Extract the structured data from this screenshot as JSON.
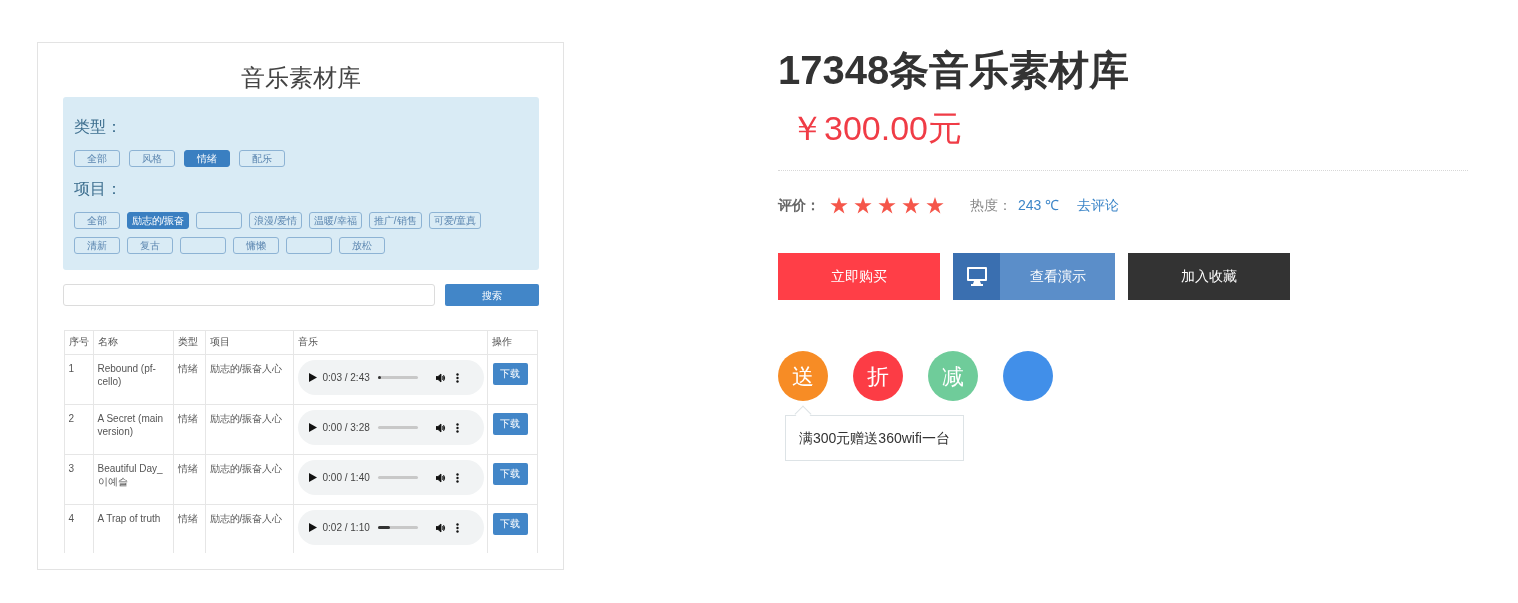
{
  "preview": {
    "title": "音乐素材库",
    "type_label": "类型：",
    "type_filters": [
      {
        "label": "全部",
        "selected": false
      },
      {
        "label": "风格",
        "selected": false
      },
      {
        "label": "情绪",
        "selected": true
      },
      {
        "label": "配乐",
        "selected": false
      }
    ],
    "project_label": "项目：",
    "project_filters": [
      [
        {
          "label": "全部",
          "selected": false
        },
        {
          "label": "励志的/振奋",
          "selected": true
        },
        {
          "selected": false
        },
        {
          "label": "浪漫/爱情",
          "selected": false
        },
        {
          "label": "温暖/幸福",
          "selected": false
        },
        {
          "label": "推广/销售",
          "selected": false
        },
        {
          "label": "可爱/童真",
          "selected": false
        }
      ],
      [
        {
          "label": "清新",
          "selected": false
        },
        {
          "label": "复古",
          "selected": false
        },
        {
          "selected": false
        },
        {
          "label": "慵懒",
          "selected": false
        },
        {
          "selected": false
        },
        {
          "label": "放松",
          "selected": false
        }
      ]
    ],
    "search_button": "搜索",
    "table": {
      "columns": [
        "序号",
        "名称",
        "类型",
        "项目",
        "音乐",
        "操作"
      ],
      "rows": [
        {
          "no": "1",
          "name": "Rebound (pf-cello)",
          "type": "情绪",
          "project": "励志的/振奋人心",
          "time": "0:03 / 2:43",
          "level": 0.08,
          "action": "下载"
        },
        {
          "no": "2",
          "name": "A Secret (main version)",
          "type": "情绪",
          "project": "励志的/振奋人心",
          "time": "0:00 / 3:28",
          "level": 0,
          "action": "下载"
        },
        {
          "no": "3",
          "name": "Beautiful Day_ 이예슬",
          "type": "情绪",
          "project": "励志的/振奋人心",
          "time": "0:00 / 1:40",
          "level": 0,
          "action": "下载"
        },
        {
          "no": "4",
          "name": "A Trap of truth",
          "type": "情绪",
          "project": "励志的/振奋人心",
          "time": "0:02 / 1:10",
          "level": 0.3,
          "action": "下载"
        }
      ]
    }
  },
  "product": {
    "title": "17348条音乐素材库",
    "price": "￥300.00元",
    "rating_label": "评价：",
    "rating": {
      "stars": 5
    },
    "heat_label": "热度：",
    "heat": "243 ℃",
    "review_link": "去评论",
    "buttons": [
      {
        "kind": "buy",
        "label": "立即购买"
      },
      {
        "kind": "demo",
        "label": "查看演示"
      },
      {
        "kind": "favorite",
        "label": "加入收藏"
      }
    ],
    "badges": [
      {
        "label": "送",
        "color": "#f78c25",
        "tooltip": "满300元赠送360wifi一台"
      },
      {
        "label": "折",
        "color": "#fc3c45"
      },
      {
        "label": "减",
        "color": "#6fcc9a"
      },
      {
        "color": "#418fe9"
      }
    ]
  }
}
